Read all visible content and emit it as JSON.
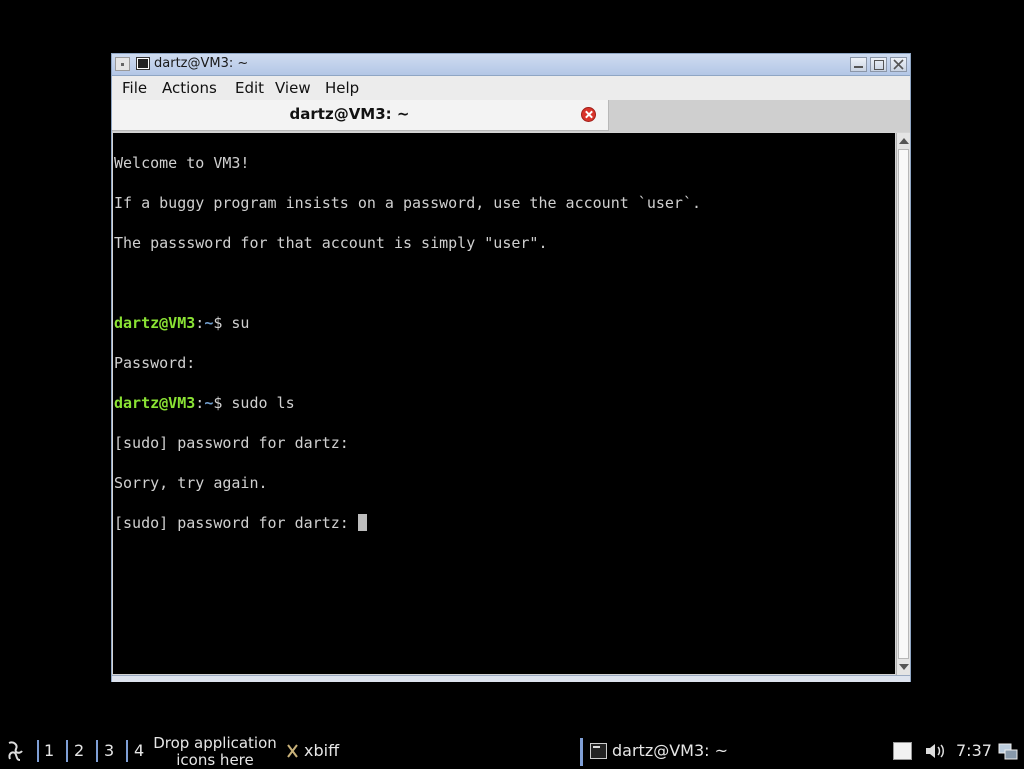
{
  "window": {
    "title": "dartz@VM3: ~",
    "menus": [
      "File",
      "Actions",
      "Edit",
      "View",
      "Help"
    ],
    "tab_label": "dartz@VM3: ~"
  },
  "terminal": {
    "welcome": "Welcome to VM3!",
    "notice1": "If a buggy program insists on a password, use the account `user`.",
    "notice2": "The passsword for that account is simply \"user\".",
    "prompt_user": "dartz@VM3",
    "prompt_colon": ":",
    "prompt_path": "~",
    "prompt_symbol": "$ ",
    "cmd1": "su",
    "out1": "Password:",
    "cmd2": "sudo ls",
    "out2": "[sudo] password for dartz:",
    "out3": "Sorry, try again.",
    "out4": "[sudo] password for dartz: "
  },
  "taskbar": {
    "desktops": [
      "1",
      "2",
      "3",
      "4"
    ],
    "drop_line1": "Drop application",
    "drop_line2": "icons here",
    "launcher_label": "xbiff",
    "task_label": "dartz@VM3: ~",
    "clock": "7:37"
  },
  "colors": {
    "prompt_user": "#8ae234",
    "prompt_path": "#729fcf",
    "accent": "#7f9fd6"
  }
}
